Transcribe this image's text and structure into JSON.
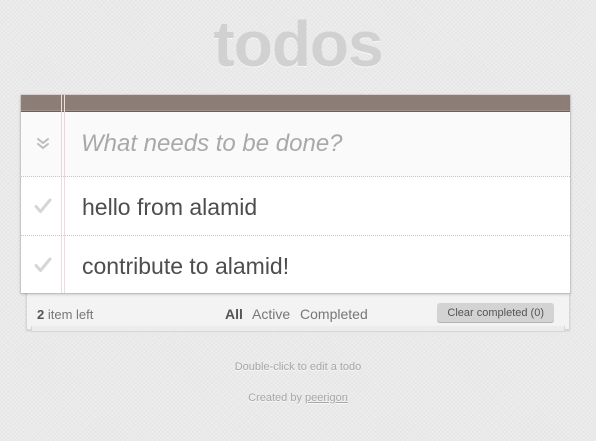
{
  "app": {
    "title": "todos"
  },
  "new_todo": {
    "placeholder": "What needs to be done?",
    "value": ""
  },
  "toggle_all": {
    "icon": "chevron-double-down-icon"
  },
  "todos": [
    {
      "title": "hello from alamid",
      "completed": false,
      "icon": "checkmark-icon"
    },
    {
      "title": "contribute to alamid!",
      "completed": false,
      "icon": "checkmark-icon"
    }
  ],
  "footer": {
    "count": "2",
    "count_suffix": "item left",
    "filters": [
      {
        "label": "All",
        "selected": true
      },
      {
        "label": "Active",
        "selected": false
      },
      {
        "label": "Completed",
        "selected": false
      }
    ],
    "clear_completed": "Clear completed (0)"
  },
  "info": {
    "edit_hint": "Double-click to edit a todo",
    "created_by_prefix": "Created by",
    "author": "peerigon"
  },
  "colors": {
    "header_band": "#8d7d77",
    "background": "#eaeaea",
    "title": "#d1d1d1",
    "margin_line": "#f1dcdc"
  }
}
